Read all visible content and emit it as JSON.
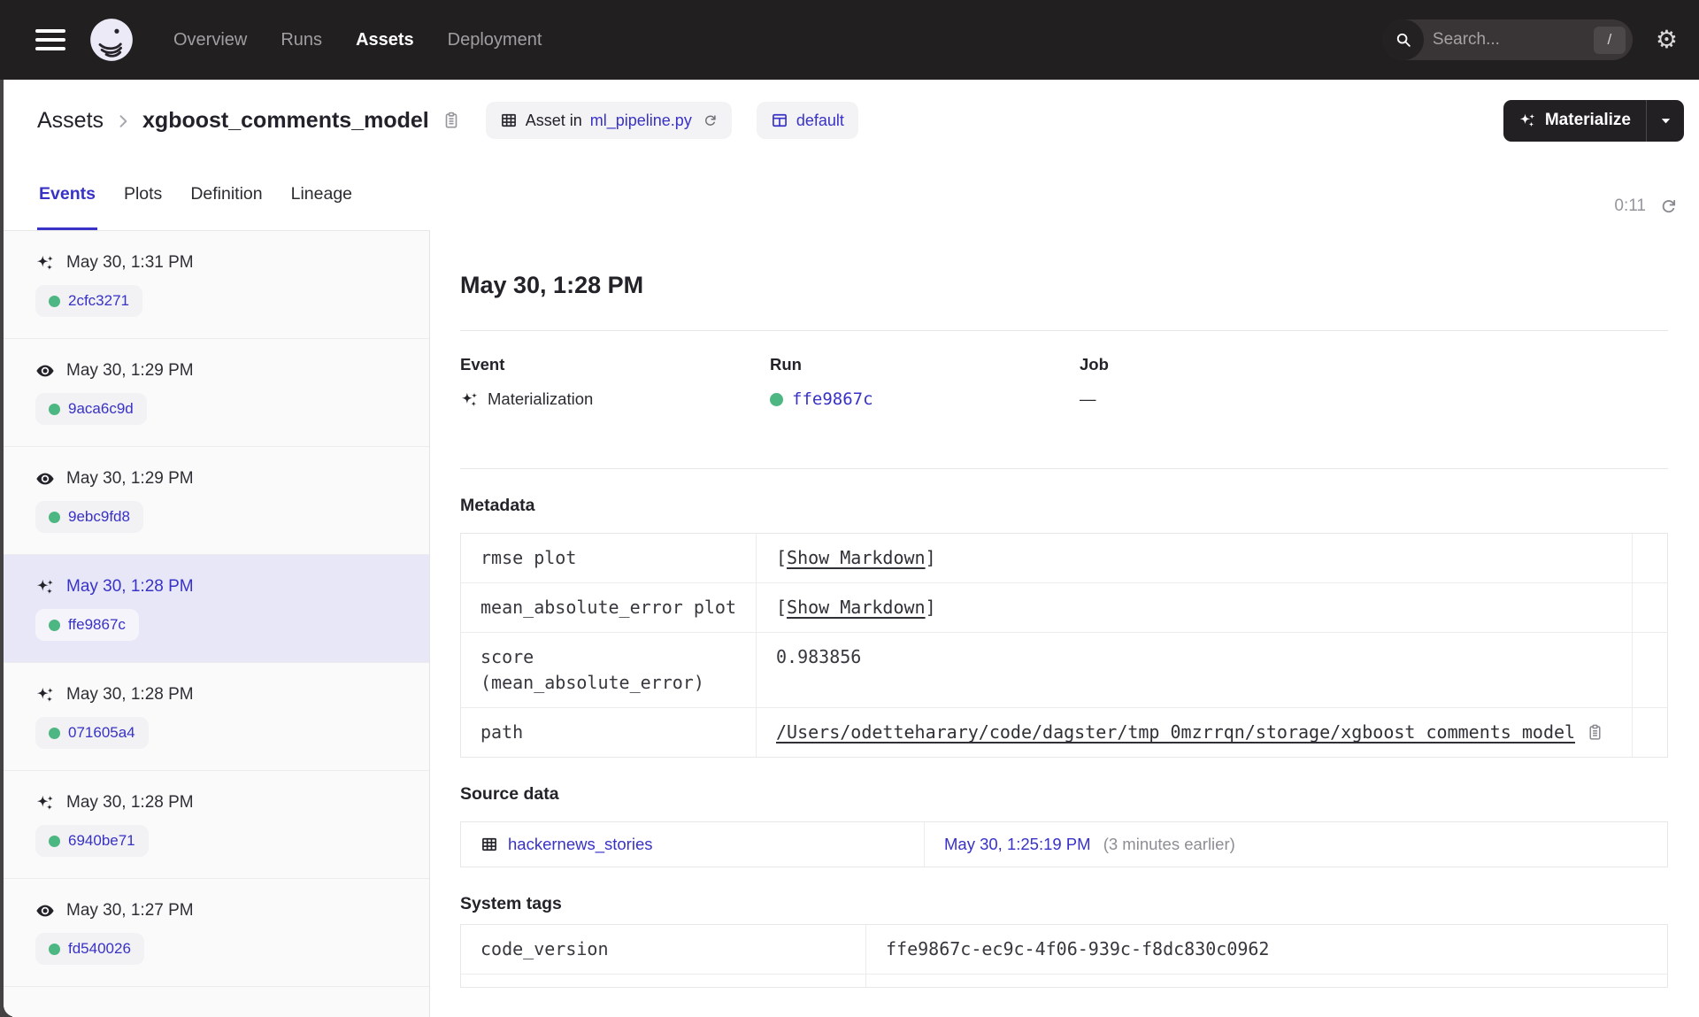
{
  "nav": {
    "links": [
      {
        "label": "Overview",
        "active": false
      },
      {
        "label": "Runs",
        "active": false
      },
      {
        "label": "Assets",
        "active": true
      },
      {
        "label": "Deployment",
        "active": false
      }
    ],
    "search": {
      "placeholder": "Search...",
      "shortcut_key": "/"
    }
  },
  "header": {
    "breadcrumb": {
      "section": "Assets",
      "asset_name": "xgboost_comments_model"
    },
    "asset_badge": {
      "prefix": "Asset in",
      "code_location": "ml_pipeline.py"
    },
    "group_badge": {
      "label": "default"
    },
    "materialize": {
      "label": "Materialize"
    }
  },
  "tabs": {
    "items": [
      {
        "label": "Events",
        "active": true
      },
      {
        "label": "Plots",
        "active": false
      },
      {
        "label": "Definition",
        "active": false
      },
      {
        "label": "Lineage",
        "active": false
      }
    ],
    "timer": "0:11"
  },
  "sidebar": {
    "items": [
      {
        "icon": "materialization-sparkle",
        "date": "May 30, 1:31 PM",
        "run_id": "2cfc3271",
        "selected": false
      },
      {
        "icon": "observation-eye",
        "date": "May 30, 1:29 PM",
        "run_id": "9aca6c9d",
        "selected": false
      },
      {
        "icon": "observation-eye",
        "date": "May 30, 1:29 PM",
        "run_id": "9ebc9fd8",
        "selected": false
      },
      {
        "icon": "materialization-sparkle",
        "date": "May 30, 1:28 PM",
        "run_id": "ffe9867c",
        "selected": true
      },
      {
        "icon": "materialization-sparkle",
        "date": "May 30, 1:28 PM",
        "run_id": "071605a4",
        "selected": false
      },
      {
        "icon": "materialization-sparkle",
        "date": "May 30, 1:28 PM",
        "run_id": "6940be71",
        "selected": false
      },
      {
        "icon": "observation-eye",
        "date": "May 30, 1:27 PM",
        "run_id": "fd540026",
        "selected": false
      }
    ]
  },
  "detail": {
    "title": "May 30, 1:28 PM",
    "columns": {
      "event_label": "Event",
      "event_value": "Materialization",
      "run_label": "Run",
      "run_id": "ffe9867c",
      "job_label": "Job",
      "job_value": "—"
    },
    "metadata": {
      "heading": "Metadata",
      "bracket_open": "[",
      "bracket_close": "]",
      "markdown_link": "Show Markdown",
      "rows": [
        {
          "key": "rmse plot",
          "value_type": "markdown"
        },
        {
          "key": "mean_absolute_error plot",
          "value_type": "markdown"
        },
        {
          "key_line1": "score",
          "key_line2": "(mean_absolute_error)",
          "value": "0.983856",
          "value_type": "text"
        },
        {
          "key": "path",
          "value": "/Users/odetteharary/code/dagster/tmp_0mzrrqn/storage/xgboost_comments_model",
          "value_type": "link"
        }
      ]
    },
    "source_data": {
      "heading": "Source data",
      "asset": "hackernews_stories",
      "timestamp": "May 30, 1:25:19 PM",
      "relative": "(3 minutes earlier)"
    },
    "system_tags": {
      "heading": "System tags",
      "rows": [
        {
          "key": "code_version",
          "value": "ffe9867c-ec9c-4f06-939c-f8dc830c0962"
        }
      ]
    }
  },
  "colors": {
    "accent": "#3832C6",
    "green": "#4CB782",
    "nav_bg": "#221F20",
    "selected_bg": "#E8E7F8"
  }
}
